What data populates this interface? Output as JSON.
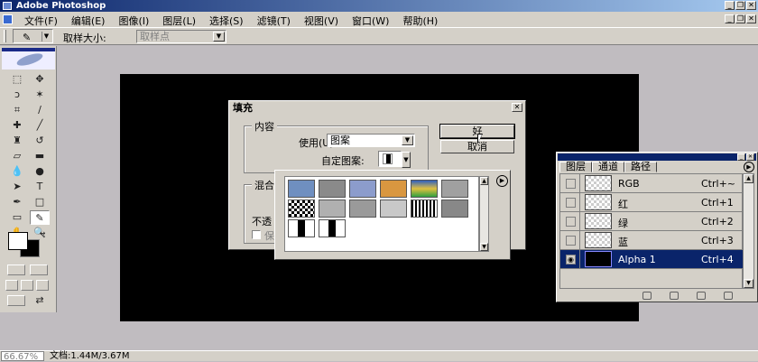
{
  "window": {
    "title": "Adobe Photoshop"
  },
  "menu": {
    "items": [
      "文件(F)",
      "编辑(E)",
      "图像(I)",
      "图层(L)",
      "选择(S)",
      "滤镜(T)",
      "视图(V)",
      "窗口(W)",
      "帮助(H)"
    ]
  },
  "options_bar": {
    "sample_size_label": "取样大小:",
    "sample_size_value": "取样点",
    "tool_icon": "eyedropper-icon"
  },
  "toolbox": {
    "tools": [
      "rect-marquee-icon",
      "move-icon",
      "lasso-icon",
      "magic-wand-icon",
      "crop-icon",
      "slice-icon",
      "healing-brush-icon",
      "brush-icon",
      "clone-stamp-icon",
      "history-brush-icon",
      "eraser-icon",
      "gradient-icon",
      "blur-icon",
      "dodge-icon",
      "path-select-icon",
      "type-icon",
      "pen-icon",
      "shape-icon",
      "notes-icon",
      "eyedropper-icon",
      "hand-icon",
      "zoom-icon"
    ],
    "foreground_color": "#ffffff",
    "background_color": "#000000"
  },
  "document": {
    "canvas_color": "#000000"
  },
  "status_bar": {
    "zoom": "66.67%",
    "doc_size": "文档:1.44M/3.67M"
  },
  "fill_dialog": {
    "title": "填充",
    "contents_group": "内容",
    "use_label": "使用(U):",
    "use_value": "图案",
    "custom_pattern_label": "自定图案:",
    "blending_group": "混合",
    "opacity_label": "不透",
    "preserve_label": "保",
    "ok_label": "好",
    "cancel_label": "取消"
  },
  "pattern_picker": {
    "patterns": [
      {
        "name": "bubbles",
        "color": "#6f8fc0"
      },
      {
        "name": "stone",
        "color": "#8a8a8a"
      },
      {
        "name": "blue-fabric",
        "color": "#8c9ccc"
      },
      {
        "name": "orange-tile",
        "color": "#d99740"
      },
      {
        "name": "rainbow",
        "color": "#d0a050"
      },
      {
        "name": "gray-noise",
        "color": "#a0a0a0"
      },
      {
        "name": "checker-bw",
        "color": "#333333"
      },
      {
        "name": "gray-bumps",
        "color": "#b0b0b0"
      },
      {
        "name": "mottled",
        "color": "#9a9a9a"
      },
      {
        "name": "light-speckle",
        "color": "#c8c8c8"
      },
      {
        "name": "dotted-rows",
        "color": "#444444"
      },
      {
        "name": "granite",
        "color": "#888888"
      },
      {
        "name": "black-white-bar-1",
        "color": "#000000"
      },
      {
        "name": "black-white-bar-2",
        "color": "#000000"
      }
    ]
  },
  "channels_panel": {
    "tabs": [
      "图层",
      "通道",
      "路径"
    ],
    "active_tab": "通道",
    "rows": [
      {
        "name": "RGB",
        "shortcut": "Ctrl+~",
        "visible": false,
        "selected": false
      },
      {
        "name": "红",
        "shortcut": "Ctrl+1",
        "visible": false,
        "selected": false
      },
      {
        "name": "绿",
        "shortcut": "Ctrl+2",
        "visible": false,
        "selected": false
      },
      {
        "name": "蓝",
        "shortcut": "Ctrl+3",
        "visible": false,
        "selected": false
      },
      {
        "name": "Alpha 1",
        "shortcut": "Ctrl+4",
        "visible": true,
        "selected": true
      }
    ]
  }
}
